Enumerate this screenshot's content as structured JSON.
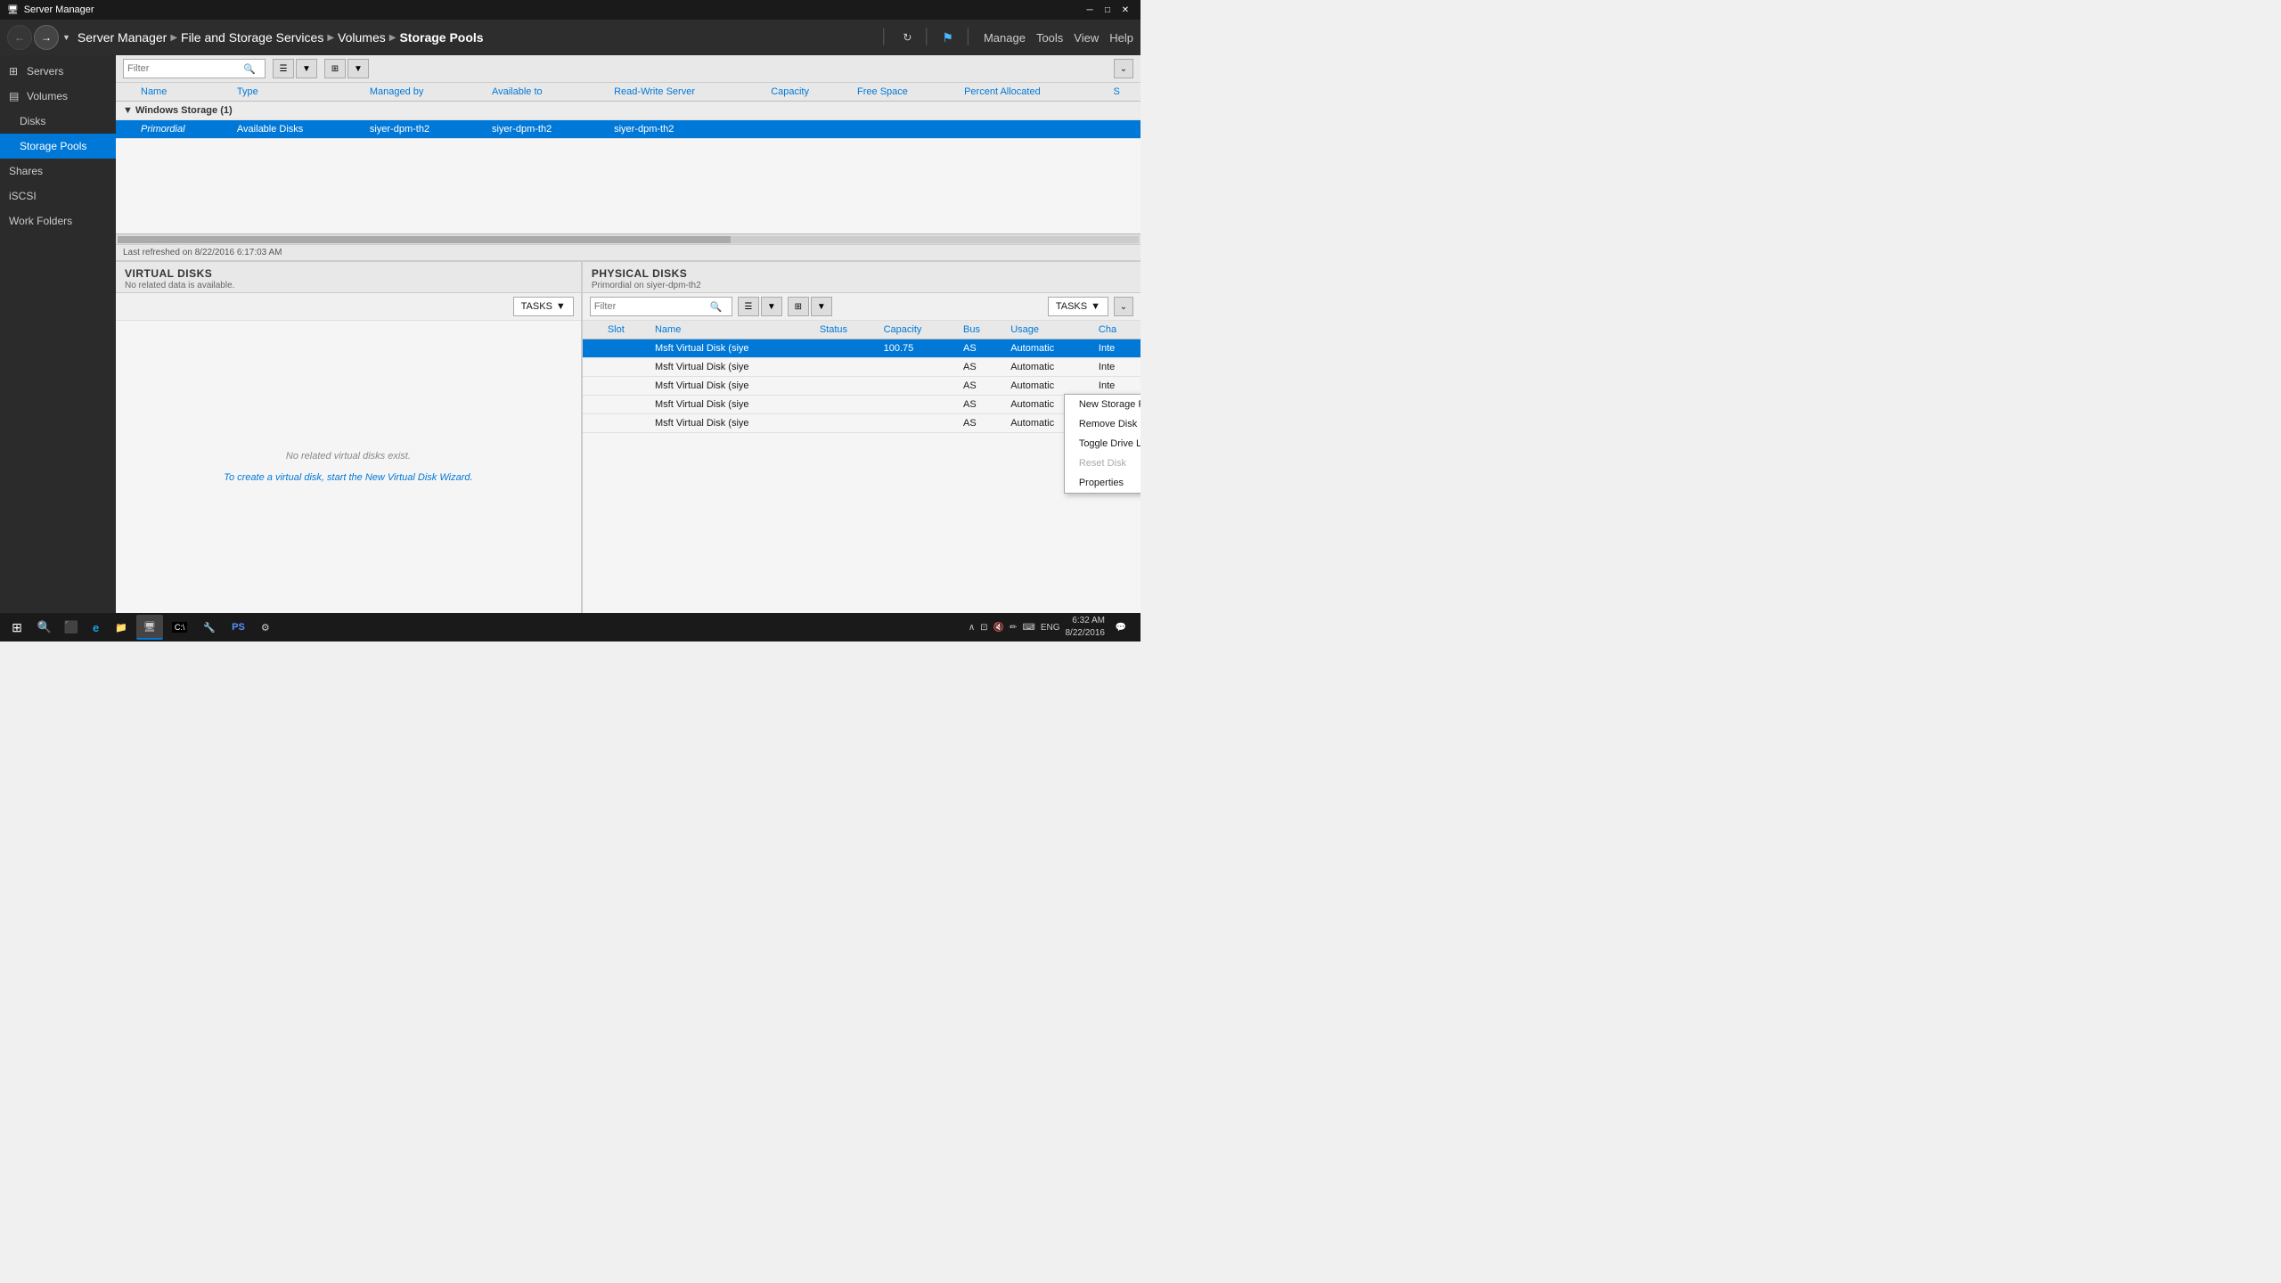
{
  "titlebar": {
    "title": "Server Manager",
    "icon": "🖥"
  },
  "navbar": {
    "path": [
      "Server Manager",
      "File and Storage Services",
      "Volumes",
      "Storage Pools"
    ],
    "separators": [
      "▶",
      "▶",
      "▶"
    ],
    "actions": [
      "Manage",
      "Tools",
      "View",
      "Help"
    ],
    "refresh": "↻",
    "flag": "🏴"
  },
  "sidebar": {
    "items": [
      {
        "label": "Servers",
        "icon": "☰",
        "sub": false,
        "active": false
      },
      {
        "label": "Volumes",
        "icon": "▤",
        "sub": false,
        "active": false
      },
      {
        "label": "Disks",
        "icon": "⬡",
        "sub": true,
        "active": false
      },
      {
        "label": "Storage Pools",
        "icon": "⬡",
        "sub": true,
        "active": true
      },
      {
        "label": "Shares",
        "icon": "⬡",
        "sub": false,
        "active": false
      },
      {
        "label": "iSCSI",
        "icon": "⬡",
        "sub": false,
        "active": false
      },
      {
        "label": "Work Folders",
        "icon": "⬡",
        "sub": false,
        "active": false
      }
    ]
  },
  "storage_pools": {
    "filter_placeholder": "Filter",
    "columns": [
      "Name",
      "Type",
      "Managed by",
      "Available to",
      "Read-Write Server",
      "Capacity",
      "Free Space",
      "Percent Allocated",
      "S"
    ],
    "group": "Windows Storage (1)",
    "rows": [
      {
        "name": "Primordial",
        "type": "Available Disks",
        "managed_by": "siyer-dpm-th2",
        "available_to": "siyer-dpm-th2",
        "rw_server": "siyer-dpm-th2",
        "capacity": "",
        "free_space": "",
        "percent_allocated": "",
        "status": "",
        "selected": true,
        "italic": true
      }
    ],
    "last_refreshed": "Last refreshed on 8/22/2016 6:17:03 AM"
  },
  "virtual_disks": {
    "title": "VIRTUAL DISKS",
    "subtitle": "No related data is available.",
    "tasks_label": "TASKS",
    "empty_text": "No related virtual disks exist.",
    "empty_link": "To create a virtual disk, start the New Virtual Disk Wizard."
  },
  "physical_disks": {
    "title": "PHYSICAL DISKS",
    "subtitle": "Primordial on siyer-dpm-th2",
    "tasks_label": "TASKS",
    "filter_placeholder": "Filter",
    "columns": [
      "Slot",
      "Name",
      "Status",
      "Capacity",
      "Bus",
      "Usage",
      "Cha"
    ],
    "rows": [
      {
        "slot": "",
        "name": "Msft Virtual Disk (siye",
        "status": "",
        "capacity": "100.75",
        "bus": "AS",
        "usage": "Automatic",
        "chassis": "Inte",
        "selected": true
      },
      {
        "slot": "",
        "name": "Msft Virtual Disk (siye",
        "status": "",
        "capacity": "",
        "bus": "AS",
        "usage": "Automatic",
        "chassis": "Inte",
        "selected": false
      },
      {
        "slot": "",
        "name": "Msft Virtual Disk (siye",
        "status": "",
        "capacity": "",
        "bus": "AS",
        "usage": "Automatic",
        "chassis": "Inte",
        "selected": false
      },
      {
        "slot": "",
        "name": "Msft Virtual Disk (siye",
        "status": "",
        "capacity": "",
        "bus": "AS",
        "usage": "Automatic",
        "chassis": "Inte",
        "selected": false
      },
      {
        "slot": "",
        "name": "Msft Virtual Disk (siye",
        "status": "",
        "capacity": "",
        "bus": "AS",
        "usage": "Automatic",
        "chassis": "Inte",
        "selected": false
      }
    ],
    "context_menu": {
      "items": [
        {
          "label": "New Storage Pool...",
          "enabled": true,
          "active": false
        },
        {
          "label": "Remove Disk",
          "enabled": true,
          "active": false
        },
        {
          "label": "Toggle Drive Light",
          "enabled": true,
          "active": false
        },
        {
          "label": "Reset Disk",
          "enabled": false,
          "active": false
        },
        {
          "label": "Properties",
          "enabled": true,
          "active": false
        }
      ]
    }
  },
  "taskbar": {
    "start": "⊞",
    "apps": [
      {
        "icon": "🔍",
        "label": "",
        "active": false
      },
      {
        "icon": "⬛",
        "label": "",
        "active": false
      },
      {
        "icon": "e",
        "label": "",
        "active": false
      },
      {
        "icon": "📁",
        "label": "",
        "active": false
      },
      {
        "icon": "🖥",
        "label": "",
        "active": true
      },
      {
        "icon": "⬛",
        "label": "",
        "active": false
      },
      {
        "icon": "🔧",
        "label": "",
        "active": false
      },
      {
        "icon": "⚡",
        "label": "",
        "active": false
      },
      {
        "icon": "⬛",
        "label": "",
        "active": false
      }
    ],
    "tray": {
      "time": "6:32 AM",
      "date": "8/22/2016",
      "lang": "ENG"
    }
  }
}
